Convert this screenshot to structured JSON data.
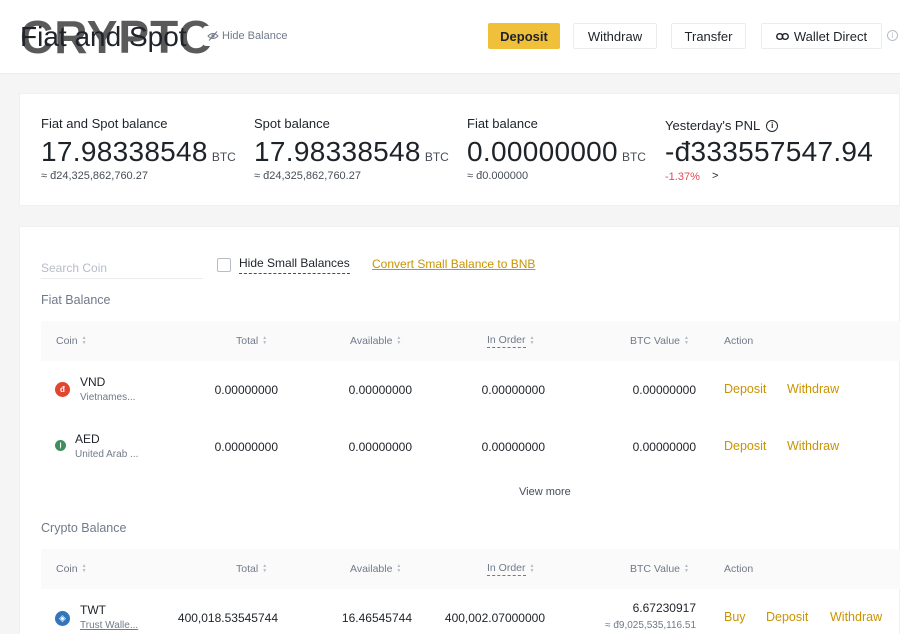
{
  "header": {
    "logo_text": "CRYPTO",
    "title": "Fiat and Spot",
    "hide_balance_label": "Hide Balance",
    "buttons": {
      "deposit": "Deposit",
      "withdraw": "Withdraw",
      "transfer": "Transfer",
      "wallet_direct": "Wallet Direct"
    },
    "info_glyph": "i"
  },
  "balances": {
    "fiat_and_spot": {
      "label": "Fiat and Spot balance",
      "value": "17.98338548",
      "unit": "BTC",
      "sub": "≈ đ24,325,862,760.27"
    },
    "spot": {
      "label": "Spot balance",
      "value": "17.98338548",
      "unit": "BTC",
      "sub": "≈ đ24,325,862,760.27"
    },
    "fiat": {
      "label": "Fiat balance",
      "value": "0.00000000",
      "unit": "BTC",
      "sub": "≈ đ0.000000"
    },
    "pnl": {
      "label": "Yesterday's PNL",
      "info_glyph": "i",
      "value": "-đ333557547.94",
      "pct": "-1.37%",
      "arrow": ">"
    }
  },
  "filters": {
    "search_placeholder": "Search Coin",
    "hide_small_label": "Hide Small Balances",
    "convert_link": "Convert Small Balance to BNB"
  },
  "table_headers": {
    "coin": "Coin",
    "total": "Total",
    "available": "Available",
    "in_order": "In Order",
    "btc_value": "BTC Value",
    "action": "Action"
  },
  "fiat_section": {
    "title": "Fiat Balance",
    "rows": [
      {
        "symbol": "VND",
        "name": "Vietnames...",
        "icon_glyph": "đ",
        "icon_color": "#e2462f",
        "total": "0.00000000",
        "available": "0.00000000",
        "in_order": "0.00000000",
        "btc_value": "0.00000000",
        "actions": [
          "Deposit",
          "Withdraw"
        ]
      },
      {
        "symbol": "AED",
        "name": "United Arab ...",
        "icon_glyph": "إ",
        "icon_color": "#3f8f5e",
        "total": "0.00000000",
        "available": "0.00000000",
        "in_order": "0.00000000",
        "btc_value": "0.00000000",
        "actions": [
          "Deposit",
          "Withdraw"
        ]
      }
    ],
    "view_more": "View more"
  },
  "crypto_section": {
    "title": "Crypto Balance",
    "rows": [
      {
        "symbol": "TWT",
        "name": "Trust Walle...",
        "icon_glyph": "◈",
        "icon_color": "#3375bb",
        "total": "400,018.53545744",
        "available": "16.46545744",
        "in_order": "400,002.07000000",
        "btc_value": "6.67230917",
        "btc_sub": "≈ đ9,025,535,116.51",
        "actions": [
          "Buy",
          "Deposit",
          "Withdraw"
        ]
      }
    ]
  },
  "colors": {
    "accent": "#f0c03a",
    "link": "#c99400",
    "negative": "#e24a55"
  }
}
